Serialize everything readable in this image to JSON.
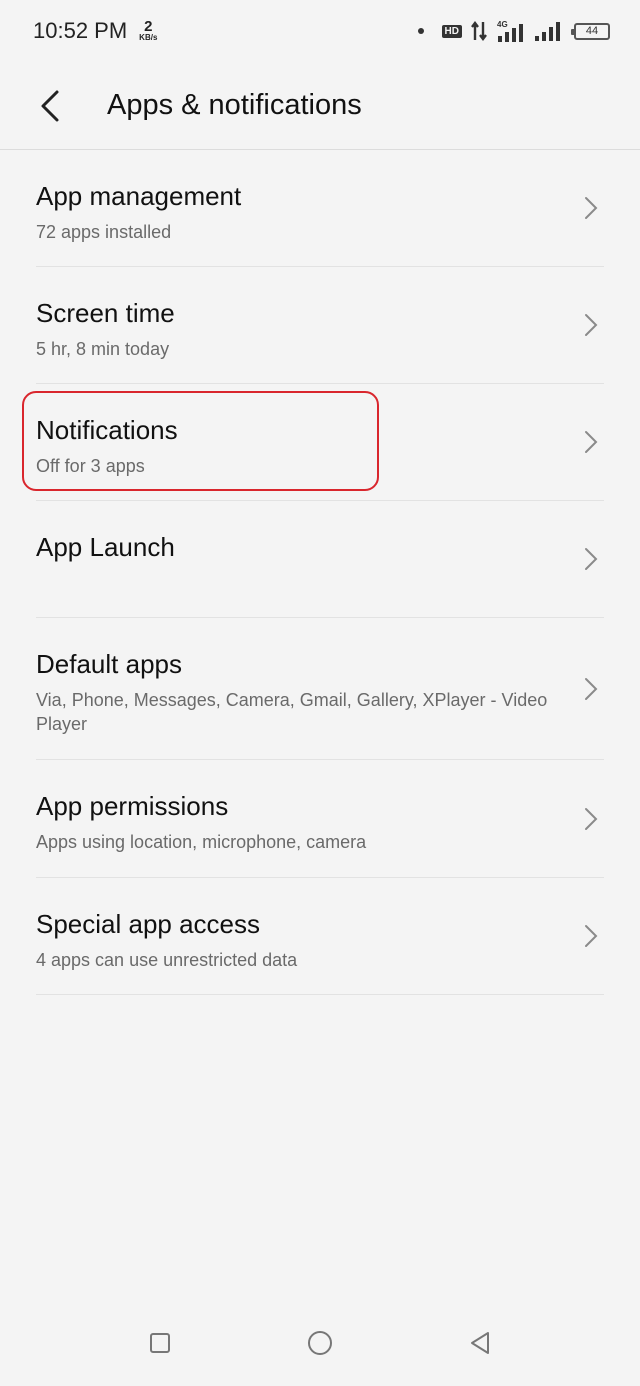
{
  "status_bar": {
    "time": "10:52 PM",
    "net_speed_value": "2",
    "net_speed_unit": "KB/s",
    "hd_label": "HD",
    "battery_level": "44"
  },
  "app_bar": {
    "title": "Apps & notifications",
    "back_icon": "chevron-left-icon"
  },
  "items": [
    {
      "title": "App management",
      "subtitle": "72 apps installed"
    },
    {
      "title": "Screen time",
      "subtitle": "5 hr, 8 min today"
    },
    {
      "title": "Notifications",
      "subtitle": "Off for 3 apps"
    },
    {
      "title": "App Launch",
      "subtitle": ""
    },
    {
      "title": "Default apps",
      "subtitle": "Via, Phone, Messages, Camera, Gmail, Gallery, XPlayer - Video Player"
    },
    {
      "title": "App permissions",
      "subtitle": "Apps using location, microphone, camera"
    },
    {
      "title": "Special app access",
      "subtitle": "4 apps can use unrestricted data"
    }
  ],
  "colors": {
    "background": "#f4f4f4",
    "highlight": "#d9262d",
    "subtitle": "#6a6a6a"
  },
  "nav_bar": {
    "recents_icon": "square-icon",
    "home_icon": "circle-icon",
    "back_icon": "triangle-back-icon"
  }
}
